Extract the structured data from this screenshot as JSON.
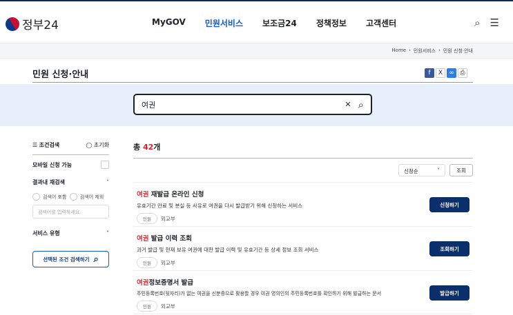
{
  "header": {
    "logo": "정부24",
    "nav": [
      "MyGOV",
      "민원서비스",
      "보조금24",
      "정책정보",
      "고객센터"
    ],
    "active_nav": 1
  },
  "breadcrumb": [
    "Home",
    "민원서비스",
    "민원 신청·안내"
  ],
  "page_title": "민원 신청·안내",
  "search": {
    "value": "여권"
  },
  "sidebar": {
    "title": "조건검색",
    "reset": "초기화",
    "mobile": "모바일 신청 가능",
    "research": "결과내 재검색",
    "include": "검색어 포함",
    "exclude": "검색어 제외",
    "placeholder": "검색어를 입력하세요.",
    "service_type": "서비스 유형",
    "search_button": "선택된 조건 검색하기"
  },
  "results": {
    "total_prefix": "총 ",
    "count": "42",
    "total_suffix": "개",
    "sort": "신청순",
    "query_button": "조회",
    "items": [
      {
        "keyword": "여권",
        "title": " 재발급 온라인 신청",
        "desc": "유효기간 만료 및 분실 등 사유로 여권을 다시 발급받기 위해 신청하는 서비스",
        "tag": "민원",
        "org": "외교부",
        "button": "신청하기"
      },
      {
        "keyword": "여권",
        "title": " 발급 이력 조회",
        "desc": "과거 발급 및 현재 보유 여권에 대한 발급 이력 및 유효기간 등 상세 정보 조회 서비스",
        "tag": "민원",
        "org": "외교부",
        "button": "조회하기"
      },
      {
        "keyword": "여권",
        "title": "정보증명서 발급",
        "desc": "주민등록번호(뒷자리)가 없는 여권을 신분증으로 활용할 경우 여권 명의인의 주민등록번호를 확인하기 위해 발급하는 문서",
        "tag": "민원",
        "org": "외교부",
        "button": "발급하기"
      }
    ]
  }
}
